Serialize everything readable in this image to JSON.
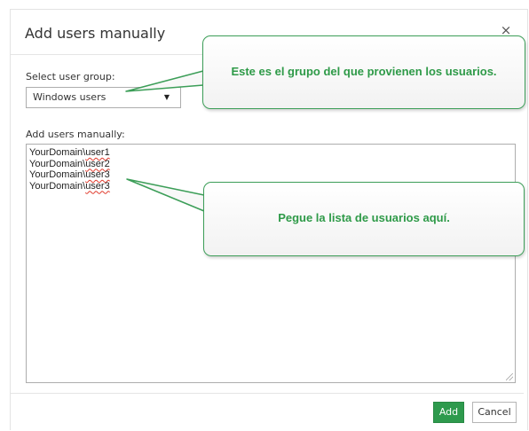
{
  "dialog": {
    "title": "Add users manually",
    "close_glyph": "×"
  },
  "user_group": {
    "label": "Select user group:",
    "selected": "Windows users",
    "arrow_glyph": "▼"
  },
  "users": {
    "label": "Add users manually:",
    "lines": [
      {
        "domain": "YourDomain\\",
        "user": "user1"
      },
      {
        "domain": "YourDomain\\",
        "user": "user2"
      },
      {
        "domain": "YourDomain\\",
        "user": "user3"
      },
      {
        "domain": "YourDomain\\",
        "user": "user3"
      }
    ]
  },
  "buttons": {
    "add_label": "Add",
    "cancel_label": "Cancel"
  },
  "callouts": {
    "group_note": "Este es el grupo del que provienen los usuarios.",
    "paste_note": "Pegue la lista de usuarios aquí."
  },
  "colors": {
    "accent_green": "#2e9a4d",
    "callout_border": "#3c9e58",
    "spellcheck": "#e0392b"
  },
  "icons": {
    "close": "close-icon",
    "dropdown": "chevron-down-icon",
    "resize": "resize-grip-icon"
  }
}
